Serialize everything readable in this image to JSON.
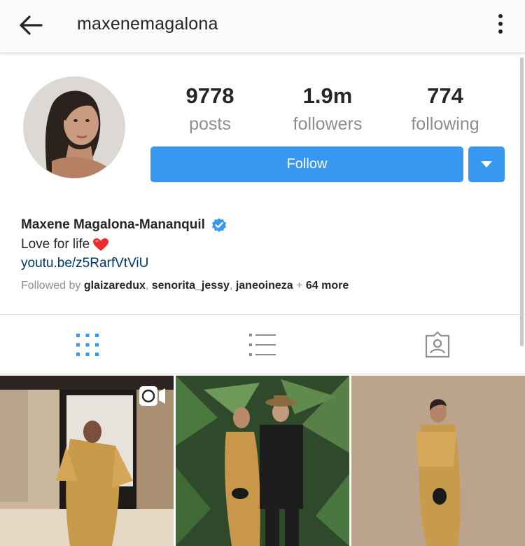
{
  "header": {
    "username": "maxenemagalona"
  },
  "profile": {
    "stats": [
      {
        "value": "9778",
        "label": "posts"
      },
      {
        "value": "1.9m",
        "label": "followers"
      },
      {
        "value": "774",
        "label": "following"
      }
    ],
    "follow_label": "Follow",
    "full_name": "Maxene Magalona-Mananquil",
    "bio_text": "Love for life",
    "bio_link": "youtu.be/z5RarfVtViU",
    "followed_by": {
      "prefix": "Followed by",
      "users": [
        "glaizaredux",
        "senorita_jessy",
        "janeoineza"
      ],
      "more": "64 more"
    }
  },
  "tabs": [
    {
      "icon": "grid-icon",
      "active": true
    },
    {
      "icon": "list-icon",
      "active": false
    },
    {
      "icon": "tagged-icon",
      "active": false
    }
  ],
  "colors": {
    "accent": "#3897f0",
    "verified": "#3897f0",
    "link": "#003569",
    "muted": "#8e8e8e",
    "heart": "#ed2d2d"
  }
}
